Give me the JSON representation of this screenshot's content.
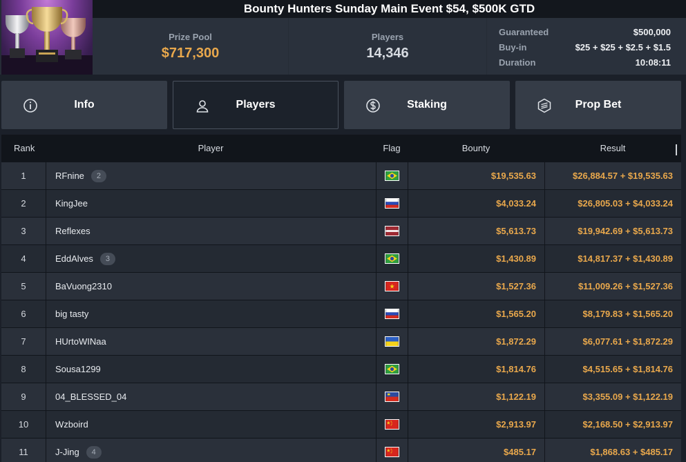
{
  "header": {
    "title": "Bounty Hunters Sunday Main Event $54, $500K GTD",
    "prize_pool_label": "Prize Pool",
    "prize_pool_value": "$717,300",
    "players_label": "Players",
    "players_value": "14,346",
    "meta": [
      {
        "key": "Guaranteed",
        "value": "$500,000"
      },
      {
        "key": "Buy-in",
        "value": "$25 + $25 + $2.5 + $1.5"
      },
      {
        "key": "Duration",
        "value": "10:08:11"
      }
    ]
  },
  "tabs": [
    {
      "label": "Info",
      "icon": "info-icon",
      "active": false
    },
    {
      "label": "Players",
      "icon": "user-icon",
      "active": true
    },
    {
      "label": "Staking",
      "icon": "dollar-coin-icon",
      "active": false
    },
    {
      "label": "Prop Bet",
      "icon": "prop-bet-icon",
      "active": false
    }
  ],
  "table": {
    "columns": [
      "Rank",
      "Player",
      "Flag",
      "Bounty",
      "Result"
    ],
    "rows": [
      {
        "rank": "1",
        "player": "RFnine",
        "badge": "2",
        "flag": "brazil",
        "bounty": "$19,535.63",
        "result": "$26,884.57 + $19,535.63"
      },
      {
        "rank": "2",
        "player": "KingJee",
        "badge": "",
        "flag": "russia",
        "bounty": "$4,033.24",
        "result": "$26,805.03 + $4,033.24"
      },
      {
        "rank": "3",
        "player": "Reflexes",
        "badge": "",
        "flag": "latvia",
        "bounty": "$5,613.73",
        "result": "$19,942.69 + $5,613.73"
      },
      {
        "rank": "4",
        "player": "EddAlves",
        "badge": "3",
        "flag": "brazil",
        "bounty": "$1,430.89",
        "result": "$14,817.37 + $1,430.89"
      },
      {
        "rank": "5",
        "player": "BaVuong2310",
        "badge": "",
        "flag": "vietnam",
        "bounty": "$1,527.36",
        "result": "$11,009.26 + $1,527.36"
      },
      {
        "rank": "6",
        "player": "big tasty",
        "badge": "",
        "flag": "russia",
        "bounty": "$1,565.20",
        "result": "$8,179.83 + $1,565.20"
      },
      {
        "rank": "7",
        "player": "HUrtoWINaa",
        "badge": "",
        "flag": "ukraine",
        "bounty": "$1,872.29",
        "result": "$6,077.61 + $1,872.29"
      },
      {
        "rank": "8",
        "player": "Sousa1299",
        "badge": "",
        "flag": "brazil",
        "bounty": "$1,814.76",
        "result": "$4,515.65 + $1,814.76"
      },
      {
        "rank": "9",
        "player": "04_BLESSED_04",
        "badge": "",
        "flag": "liechtenstein",
        "bounty": "$1,122.19",
        "result": "$3,355.09 + $1,122.19"
      },
      {
        "rank": "10",
        "player": "Wzboird",
        "badge": "",
        "flag": "china",
        "bounty": "$2,913.97",
        "result": "$2,168.50 + $2,913.97"
      },
      {
        "rank": "11",
        "player": "J-Jing",
        "badge": "4",
        "flag": "china",
        "bounty": "$485.17",
        "result": "$1,868.63 + $485.17"
      }
    ]
  },
  "colors": {
    "accent_gold": "#e9a84c",
    "background": "#1b2029",
    "row_odd": "#2a303a",
    "row_even": "#242a33"
  }
}
